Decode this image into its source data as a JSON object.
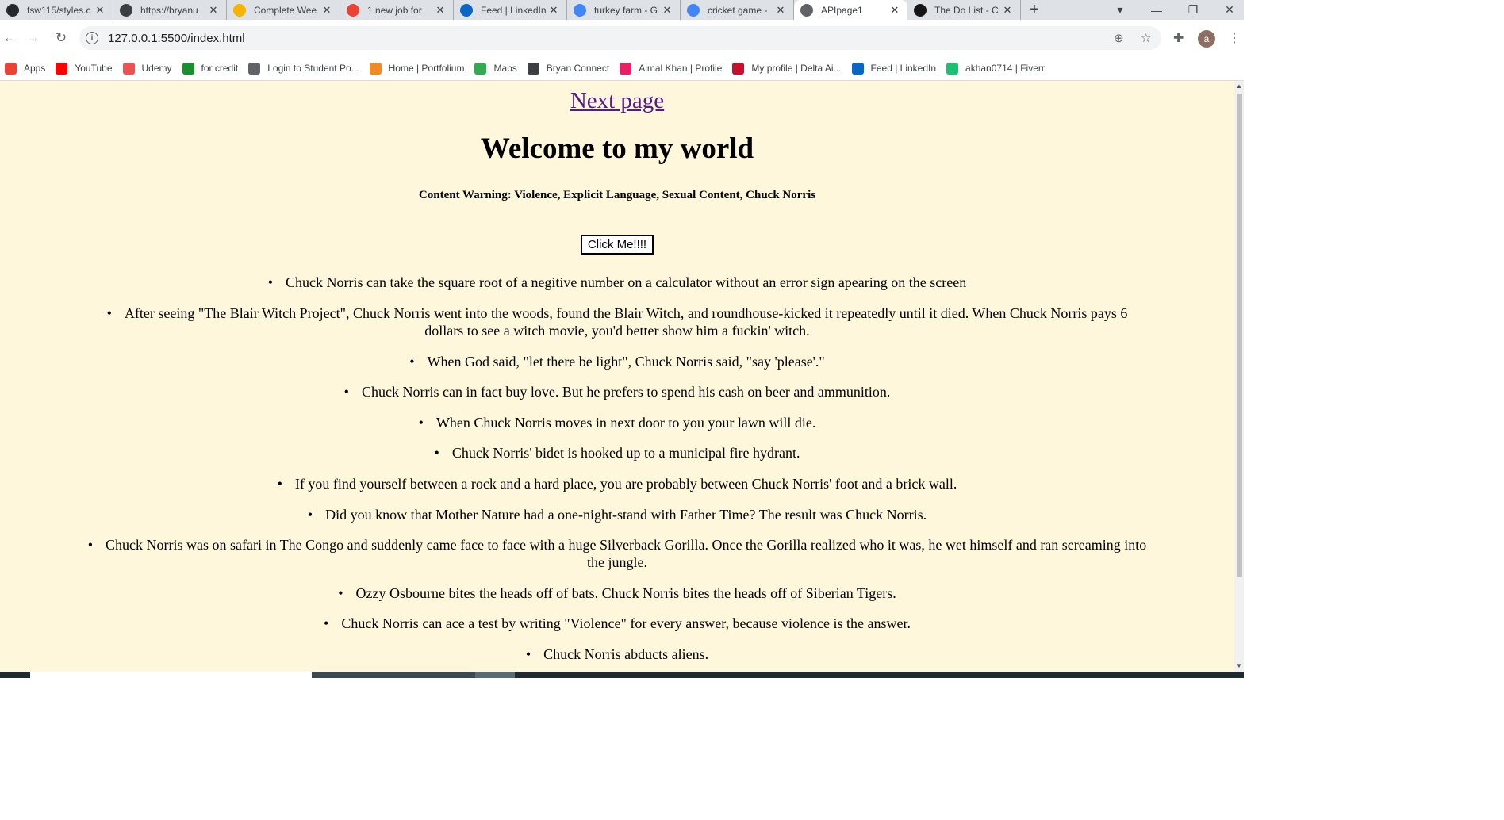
{
  "browser": {
    "tabs": [
      {
        "title": "fsw115/styles.c",
        "icon": "github-icon",
        "color": "#24292e"
      },
      {
        "title": "https://bryanu",
        "icon": "bryan-icon",
        "color": "#3c4043"
      },
      {
        "title": "Complete Wee",
        "icon": "doc-icon",
        "color": "#f4b400"
      },
      {
        "title": "1 new job for",
        "icon": "gmail-icon",
        "color": "#ea4335"
      },
      {
        "title": "Feed | LinkedIn",
        "icon": "linkedin-icon",
        "color": "#0a66c2"
      },
      {
        "title": "turkey farm - G",
        "icon": "google-icon",
        "color": "#4285f4"
      },
      {
        "title": "cricket game -",
        "icon": "google-icon",
        "color": "#4285f4"
      },
      {
        "title": "APIpage1",
        "icon": "globe-icon",
        "color": "#5f6368"
      },
      {
        "title": "The Do List - C",
        "icon": "codesandbox-icon",
        "color": "#151515"
      }
    ],
    "url": "127.0.0.1:5500/index.html",
    "avatar_letter": "a",
    "bookmarks": [
      {
        "label": "Apps",
        "icon": "apps-icon",
        "color": "#ea4335"
      },
      {
        "label": "YouTube",
        "icon": "youtube-icon",
        "color": "#ff0000"
      },
      {
        "label": "Udemy",
        "icon": "udemy-icon",
        "color": "#ec5252"
      },
      {
        "label": "for credit",
        "icon": "ck-icon",
        "color": "#1a8f2e"
      },
      {
        "label": "Login to Student Po...",
        "icon": "globe-icon",
        "color": "#5f6368"
      },
      {
        "label": "Home | Portfolium",
        "icon": "portfolium-icon",
        "color": "#f08a24"
      },
      {
        "label": "Maps",
        "icon": "maps-icon",
        "color": "#34a853"
      },
      {
        "label": "Bryan Connect",
        "icon": "bryan-icon",
        "color": "#3c4043"
      },
      {
        "label": "Aimal Khan | Profile",
        "icon": "profile-icon",
        "color": "#e91e63"
      },
      {
        "label": "My profile | Delta Ai...",
        "icon": "delta-icon",
        "color": "#c8102e"
      },
      {
        "label": "Feed | LinkedIn",
        "icon": "linkedin-icon",
        "color": "#0a66c2"
      },
      {
        "label": "akhan0714 | Fiverr",
        "icon": "fiverr-icon",
        "color": "#1dbf73"
      }
    ]
  },
  "page": {
    "next_link": "Next page",
    "heading": "Welcome to my world",
    "warning": "Content Warning: Violence, Explicit Language, Sexual Content, Chuck Norris",
    "button_label": "Click Me!!!!",
    "jokes": [
      "Chuck Norris can take the square root of a negitive number on a calculator without an error sign apearing on the screen",
      "After seeing \"The Blair Witch Project\", Chuck Norris went into the woods, found the Blair Witch, and roundhouse-kicked it repeatedly until it died. When Chuck Norris pays 6 dollars to see a witch movie, you'd better show him a fuckin' witch.",
      "When God said, \"let there be light\", Chuck Norris said, \"say 'please'.\"",
      "Chuck Norris can in fact buy love. But he prefers to spend his cash on beer and ammunition.",
      "When Chuck Norris moves in next door to you your lawn will die.",
      "Chuck Norris' bidet is hooked up to a municipal fire hydrant.",
      "If you find yourself between a rock and a hard place, you are probably between Chuck Norris' foot and a brick wall.",
      "Did you know that Mother Nature had a one-night-stand with Father Time? The result was Chuck Norris.",
      "Chuck Norris was on safari in The Congo and suddenly came face to face with a huge Silverback Gorilla. Once the Gorilla realized who it was, he wet himself and ran screaming into the jungle.",
      "Ozzy Osbourne bites the heads off of bats. Chuck Norris bites the heads off of Siberian Tigers.",
      "Chuck Norris can ace a test by writing \"Violence\" for every answer, because violence is the answer.",
      "Chuck Norris abducts aliens."
    ]
  },
  "colors": {
    "page_background": "#fff7dc",
    "link": "#551a8b"
  }
}
